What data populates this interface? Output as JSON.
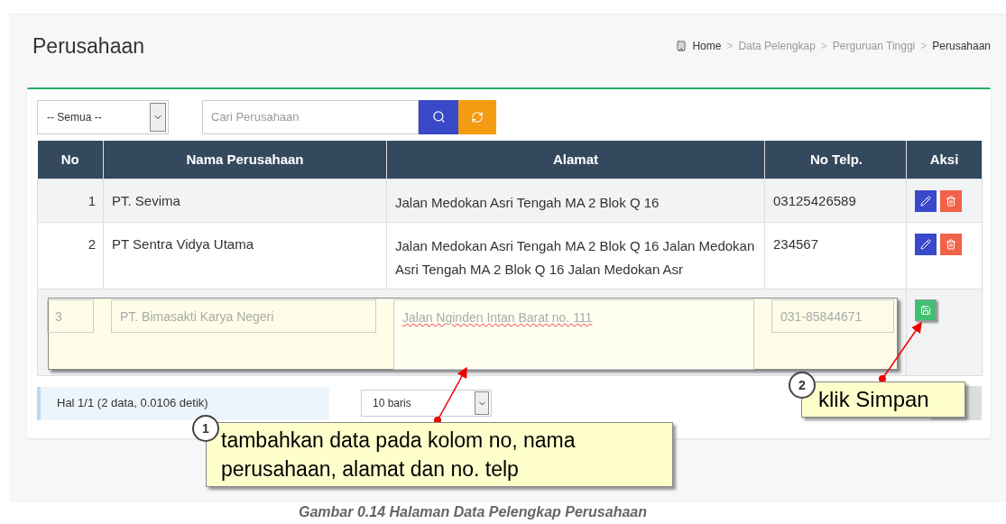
{
  "page_title": "Perusahaan",
  "breadcrumb": [
    {
      "label": "Home"
    },
    {
      "label": "Data Pelengkap"
    },
    {
      "label": "Perguruan Tinggi"
    },
    {
      "label": "Perusahaan"
    }
  ],
  "breadcrumb_separator": ">",
  "filter": {
    "select_value": "-- Semua --",
    "search_placeholder": "Cari Perusahaan"
  },
  "table": {
    "columns": [
      "No",
      "Nama Perusahaan",
      "Alamat",
      "No Telp.",
      "Aksi"
    ],
    "rows": [
      {
        "no": "1",
        "nama": "PT. Sevima",
        "alamat": "Jalan Medokan Asri Tengah MA 2 Blok Q 16",
        "telp": "03125426589"
      },
      {
        "no": "2",
        "nama": "PT Sentra Vidya Utama",
        "alamat": "Jalan Medokan Asri Tengah MA 2 Blok Q 16 Jalan Medokan Asri Tengah MA 2 Blok Q 16 Jalan Medokan Asr",
        "telp": "234567"
      }
    ],
    "new_row": {
      "no": "3",
      "nama": "PT. Bimasakti Karya Negeri",
      "alamat": "Jalan Nginden Intan Barat no. 111",
      "telp": "031-85844671"
    }
  },
  "pagination": {
    "info": "Hal 1/1 (2 data, 0.0106 detik)",
    "per_page": "10 baris"
  },
  "callouts": [
    {
      "number": "1",
      "text": "tambahkan data pada kolom no, nama perusahaan, alamat dan no. telp"
    },
    {
      "number": "2",
      "text": "klik Simpan"
    }
  ],
  "caption": "Gambar 0.14 Halaman Data Pelengkap Perusahaan"
}
